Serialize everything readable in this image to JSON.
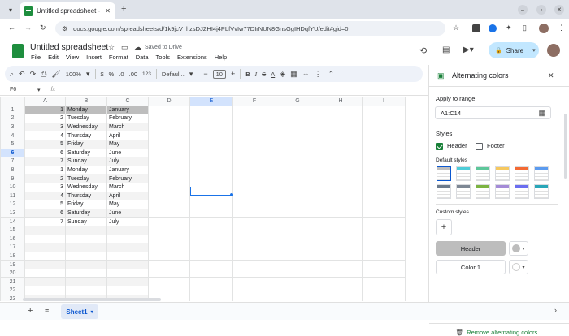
{
  "browser": {
    "tab_title": "Untitled spreadsheet - G",
    "url": "docs.google.com/spreadsheets/d/1k9jcV_hzsDJZHI4j4PLfVvIw77DIrNUN8GnsGgIHDqfYU/edit#gid=0"
  },
  "doc": {
    "title": "Untitled spreadsheet",
    "saved": "Saved to Drive",
    "share": "Share"
  },
  "menu": [
    "File",
    "Edit",
    "View",
    "Insert",
    "Format",
    "Data",
    "Tools",
    "Extensions",
    "Help"
  ],
  "toolbar": {
    "zoom": "100%",
    "currency": "$",
    "percent": "%",
    "dec_dec": ".0",
    "dec_inc": ".00",
    "number_format": "123",
    "font": "Defaul...",
    "font_size": "10",
    "bold": "B",
    "italic": "I",
    "strike": "S",
    "text_color": "A"
  },
  "formula": {
    "cell_ref": "F6",
    "fx": "fx"
  },
  "columns": [
    "A",
    "B",
    "C",
    "D",
    "E",
    "F",
    "G",
    "H",
    "I"
  ],
  "rows": [
    {
      "n": "1",
      "a": "1",
      "b": "Monday",
      "c": "January"
    },
    {
      "n": "2",
      "a": "2",
      "b": "Tuesday",
      "c": "February"
    },
    {
      "n": "3",
      "a": "3",
      "b": "Wednesday",
      "c": "March"
    },
    {
      "n": "4",
      "a": "4",
      "b": "Thursday",
      "c": "April"
    },
    {
      "n": "5",
      "a": "5",
      "b": "Friday",
      "c": "May"
    },
    {
      "n": "6",
      "a": "6",
      "b": "Saturday",
      "c": "June"
    },
    {
      "n": "7",
      "a": "7",
      "b": "Sunday",
      "c": "July"
    },
    {
      "n": "8",
      "a": "1",
      "b": "Monday",
      "c": "January"
    },
    {
      "n": "9",
      "a": "2",
      "b": "Tuesday",
      "c": "February"
    },
    {
      "n": "10",
      "a": "3",
      "b": "Wednesday",
      "c": "March"
    },
    {
      "n": "11",
      "a": "4",
      "b": "Thursday",
      "c": "April"
    },
    {
      "n": "12",
      "a": "5",
      "b": "Friday",
      "c": "May"
    },
    {
      "n": "13",
      "a": "6",
      "b": "Saturday",
      "c": "June"
    },
    {
      "n": "14",
      "a": "7",
      "b": "Sunday",
      "c": "July"
    },
    {
      "n": "15"
    },
    {
      "n": "16"
    },
    {
      "n": "17"
    },
    {
      "n": "18"
    },
    {
      "n": "19"
    },
    {
      "n": "20"
    },
    {
      "n": "21"
    },
    {
      "n": "22"
    },
    {
      "n": "23"
    }
  ],
  "panel": {
    "title": "Alternating colors",
    "apply_label": "Apply to range",
    "range": "A1:C14",
    "styles_label": "Styles",
    "header_label": "Header",
    "footer_label": "Footer",
    "header_checked": true,
    "footer_checked": false,
    "default_styles_label": "Default styles",
    "custom_styles_label": "Custom styles",
    "header_btn": "Header",
    "color1_btn": "Color 1",
    "remove": "Remove alternating colors"
  },
  "swatches": [
    "#bdbdbd",
    "#4ecdd8",
    "#5ec79a",
    "#f6c85f",
    "#f36a34",
    "#5b9bef",
    "#6d7b8c",
    "#7d8794",
    "#7cb342",
    "#a48bd7",
    "#6b6ef0",
    "#29a6b8"
  ],
  "sheet_tab": "Sheet1"
}
